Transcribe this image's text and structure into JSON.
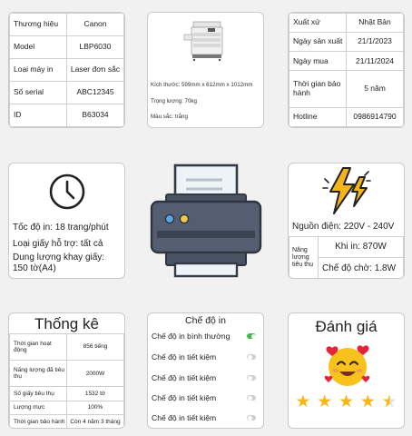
{
  "spec_table": [
    {
      "label": "Thương hiệu",
      "value": "Canon"
    },
    {
      "label": "Model",
      "value": "LBP6030"
    },
    {
      "label": "Loại máy in",
      "value": "Laser đơn sắc"
    },
    {
      "label": "Số serial",
      "value": "ABC12345"
    },
    {
      "label": "ID",
      "value": "B63034"
    }
  ],
  "photo": {
    "dimensions": "Kích thước: 599mm x 612mm x 1012mm",
    "weight": "Trọng lượng: 70kg",
    "color": "Màu sắc: trắng"
  },
  "purchase_table": [
    {
      "label": "Xuất xứ",
      "value": "Nhật Bản"
    },
    {
      "label": "Ngày sản xuất",
      "value": "21/1/2023"
    },
    {
      "label": "Ngày mua",
      "value": "21/11/2024"
    },
    {
      "label": "Thời gian bảo hành",
      "value": "5 năm"
    },
    {
      "label": "Hotline",
      "value": "0986914790"
    }
  ],
  "speed": {
    "speed_text": "Tốc độ in: 18 trang/phút",
    "paper_text": "Loại giấy hỗ trợ: tất cả",
    "tray_text_1": "Dung lượng khay giấy:",
    "tray_text_2": "150 tờ(A4)",
    "icon": "clock-icon"
  },
  "power": {
    "source": "Nguồn điện: 220V - 240V",
    "energy_label": "Năng lượng tiêu thụ",
    "on_value": "Khi in: 870W",
    "standby_value": "Chế độ chờ: 1.8W",
    "icon": "lightning-icon"
  },
  "stats": {
    "title": "Thống kê",
    "rows": [
      {
        "label": "Thời gian hoạt động",
        "value": "856 tiếng"
      },
      {
        "label": "Năng lượng đã tiêu thụ",
        "value": "2000W"
      },
      {
        "label": "Số giấy tiêu thụ",
        "value": "1532 tờ"
      },
      {
        "label": "Lượng mực",
        "value": "100%"
      },
      {
        "label": "Thời gian bảo hành",
        "value": "Còn 4 năm 3 tháng"
      }
    ]
  },
  "modes": {
    "title": "Chế độ in",
    "items": [
      {
        "label": "Chế độ in bình thường",
        "on": true
      },
      {
        "label": "Chế độ in tiết kiệm",
        "on": false
      },
      {
        "label": "Chế độ in tiết kiệm",
        "on": false
      },
      {
        "label": "Chế độ in tiết kiệm",
        "on": false
      },
      {
        "label": "Chế độ in tiết kiệm",
        "on": false
      }
    ]
  },
  "rating": {
    "title": "Đánh giá",
    "stars": 4.5,
    "max": 5,
    "accent": "#f7b71a"
  }
}
